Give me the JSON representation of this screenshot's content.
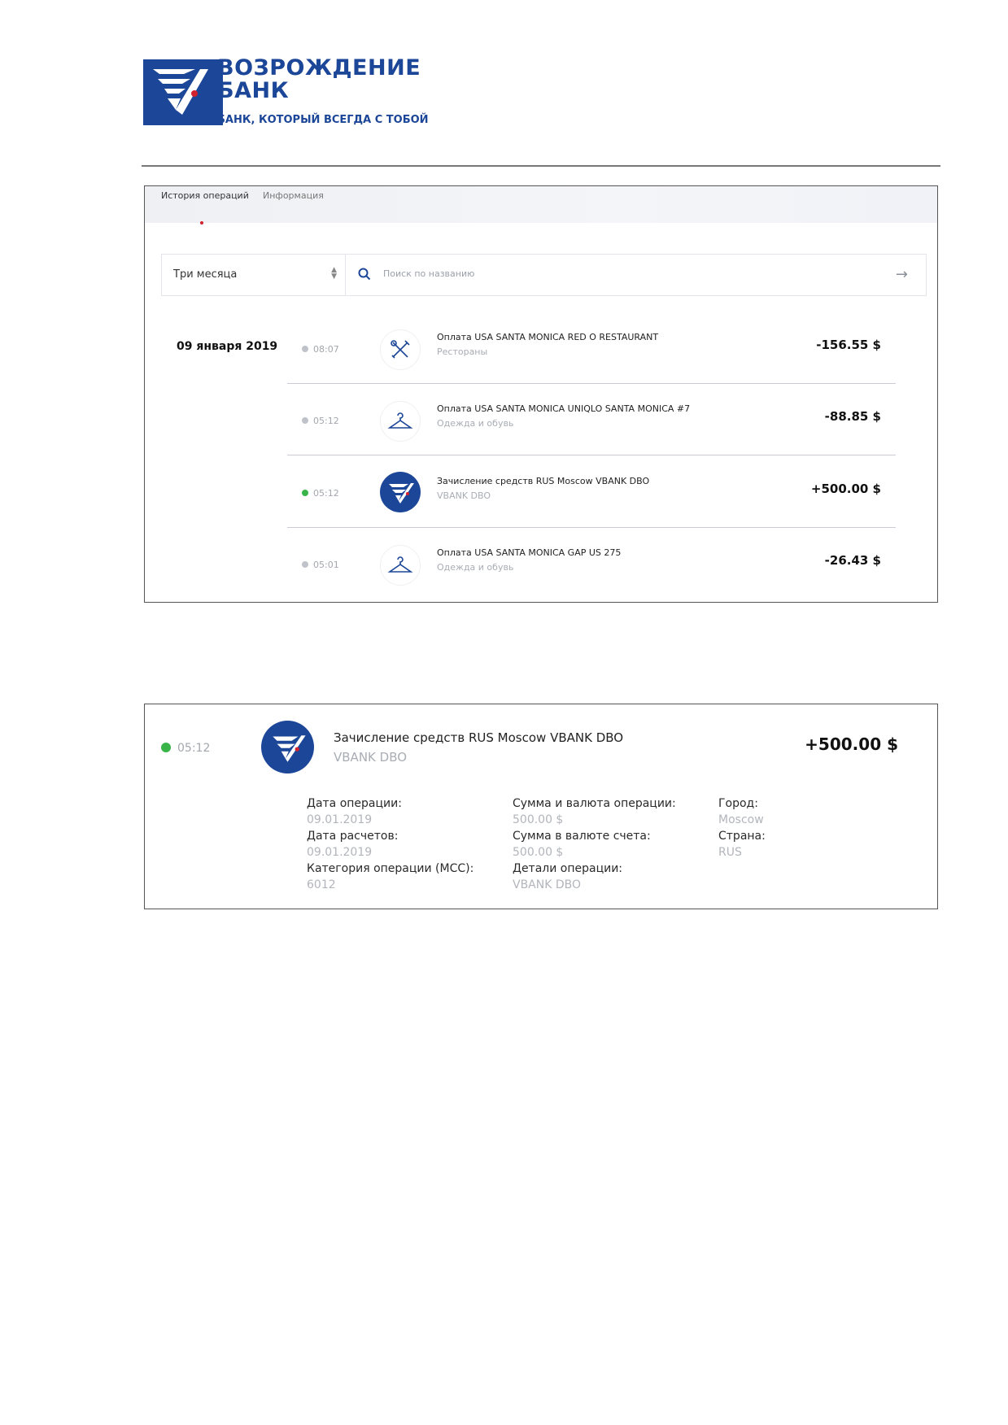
{
  "brand": {
    "line1": "ВОЗРОЖДЕНИЕ",
    "line2": "БАНК",
    "tagline": "БАНК, КОТОРЫЙ ВСЕГДА С ТОБОЙ",
    "color": "#1c4697"
  },
  "tabs": [
    {
      "label": "История операций",
      "active": true
    },
    {
      "label": "Информация",
      "active": false
    }
  ],
  "filter": {
    "period": "Три месяца",
    "search_placeholder": "Поиск по названию"
  },
  "history": {
    "date": "09 января 2019",
    "transactions": [
      {
        "time": "08:07",
        "status_icon": "clock-icon",
        "icon": "restaurant-icon",
        "title": "Оплата USA SANTA MONICA RED O RESTAURANT",
        "category": "Рестораны",
        "amount": "-156.55 $"
      },
      {
        "time": "05:12",
        "status_icon": "clock-icon",
        "icon": "hanger-icon",
        "title": "Оплата USA SANTA MONICA UNIQLO SANTA MONICA #7",
        "category": "Одежда и обувь",
        "amount": "-88.85 $"
      },
      {
        "time": "05:12",
        "status_icon": "check-icon",
        "icon": "bank-logo-icon",
        "title": "Зачисление средств RUS Moscow VBANK DBO",
        "category": "VBANK DBO",
        "amount": "+500.00 $"
      },
      {
        "time": "05:01",
        "status_icon": "clock-icon",
        "icon": "hanger-icon",
        "title": "Оплата USA SANTA MONICA GAP US 275",
        "category": "Одежда и обувь",
        "amount": "-26.43 $"
      }
    ]
  },
  "detail": {
    "time": "05:12",
    "title": "Зачисление средств RUS Moscow VBANK DBO",
    "sub": "VBANK DBO",
    "amount": "+500.00 $",
    "fields": {
      "op_date_label": "Дата операции:",
      "op_date": "09.01.2019",
      "settle_date_label": "Дата расчетов:",
      "settle_date": "09.01.2019",
      "mcc_label": "Категория операции (MCC):",
      "mcc": "6012",
      "sum_op_label": "Сумма и валюта операции:",
      "sum_op": "500.00 $",
      "sum_acc_label": "Сумма в валюте счета:",
      "sum_acc": "500.00 $",
      "details_label": "Детали операции:",
      "details": "VBANK DBO",
      "city_label": "Город:",
      "city": "Moscow",
      "country_label": "Страна:",
      "country": "RUS"
    }
  }
}
